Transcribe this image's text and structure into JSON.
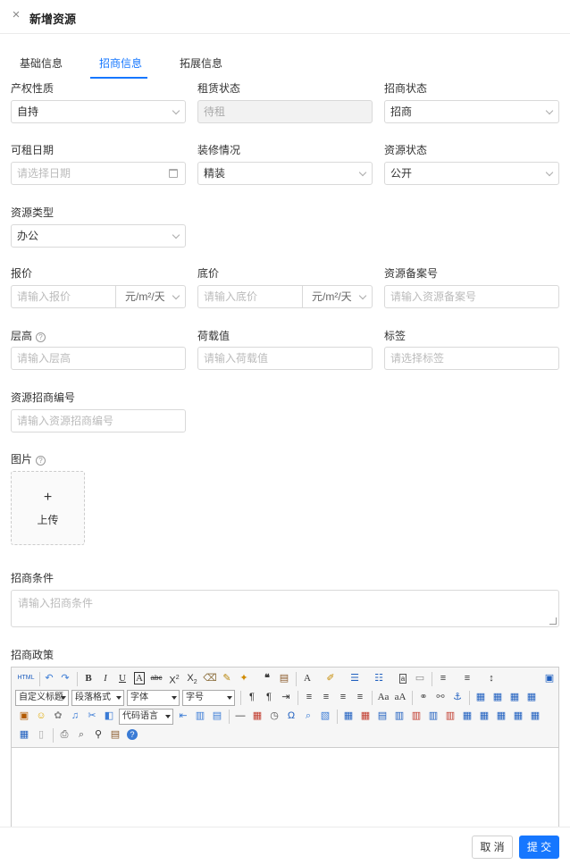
{
  "header": {
    "title": "新增资源",
    "close_icon": "×"
  },
  "tabs": [
    "基础信息",
    "招商信息",
    "拓展信息"
  ],
  "fields": {
    "property_nature": {
      "label": "产权性质",
      "value": "自持"
    },
    "lease_status": {
      "label": "租赁状态",
      "value": "待租"
    },
    "invest_status": {
      "label": "招商状态",
      "value": "招商"
    },
    "available_date": {
      "label": "可租日期",
      "placeholder": "请选择日期"
    },
    "decoration": {
      "label": "装修情况",
      "value": "精装"
    },
    "resource_status": {
      "label": "资源状态",
      "value": "公开"
    },
    "resource_type": {
      "label": "资源类型",
      "value": "办公"
    },
    "price": {
      "label": "报价",
      "placeholder": "请输入报价",
      "unit": "元/m²/天"
    },
    "floor_price": {
      "label": "底价",
      "placeholder": "请输入底价",
      "unit": "元/m²/天"
    },
    "record_no": {
      "label": "资源备案号",
      "placeholder": "请输入资源备案号"
    },
    "floor_height": {
      "label": "层高",
      "placeholder": "请输入层高"
    },
    "load": {
      "label": "荷载值",
      "placeholder": "请输入荷载值"
    },
    "tags": {
      "label": "标签",
      "placeholder": "请选择标签"
    },
    "invest_code": {
      "label": "资源招商编号",
      "placeholder": "请输入资源招商编号"
    },
    "images": {
      "label": "图片",
      "upload_plus": "+",
      "upload_text": "上传"
    },
    "conditions": {
      "label": "招商条件",
      "placeholder": "请输入招商条件"
    },
    "policy": {
      "label": "招商政策"
    }
  },
  "editor": {
    "html_btn": "HTML",
    "custom_title": "自定义标题",
    "paragraph": "段落格式",
    "font": "字体",
    "size": "字号",
    "code_lang": "代码语言"
  },
  "footer": {
    "cancel": "取 消",
    "submit": "提 交"
  },
  "colors": {
    "accent": "#1677ff",
    "border": "#d9d9d9"
  }
}
